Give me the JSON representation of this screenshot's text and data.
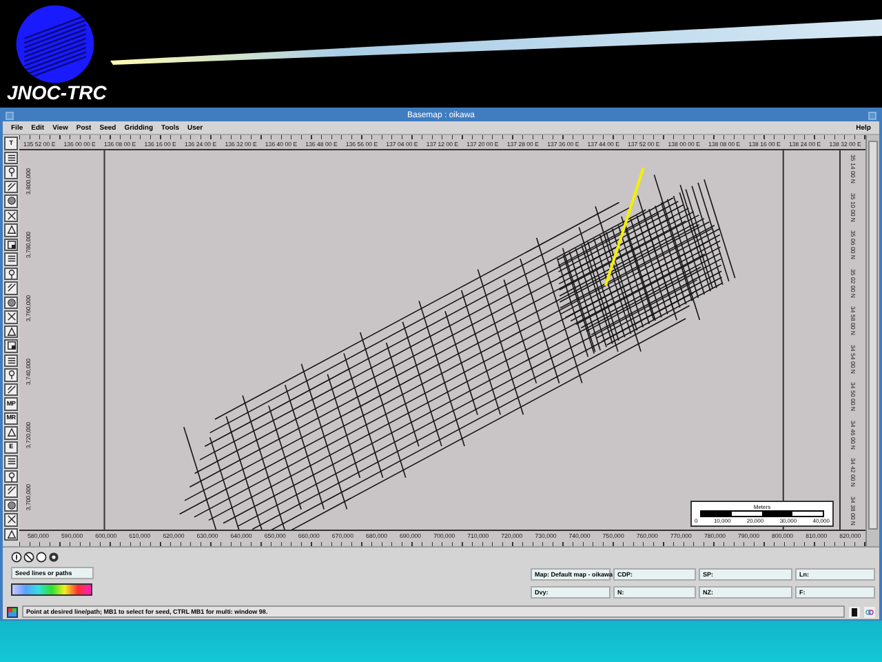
{
  "header": {
    "logo_text": "JNOC-TRC"
  },
  "window": {
    "title": "Basemap : oikawa"
  },
  "menu": {
    "items": [
      "File",
      "Edit",
      "View",
      "Post",
      "Seed",
      "Gridding",
      "Tools",
      "User"
    ],
    "help": "Help"
  },
  "toolbar": [
    {
      "kind": "text",
      "label": "T"
    },
    {
      "kind": "icon"
    },
    {
      "kind": "icon"
    },
    {
      "kind": "icon"
    },
    {
      "kind": "icon"
    },
    {
      "kind": "icon"
    },
    {
      "kind": "icon"
    },
    {
      "kind": "icon"
    },
    {
      "kind": "icon"
    },
    {
      "kind": "icon"
    },
    {
      "kind": "icon"
    },
    {
      "kind": "icon"
    },
    {
      "kind": "icon"
    },
    {
      "kind": "icon"
    },
    {
      "kind": "icon"
    },
    {
      "kind": "icon"
    },
    {
      "kind": "icon"
    },
    {
      "kind": "icon"
    },
    {
      "kind": "text",
      "label": "MP"
    },
    {
      "kind": "text",
      "label": "MR"
    },
    {
      "kind": "icon"
    },
    {
      "kind": "text",
      "label": "E"
    },
    {
      "kind": "icon"
    },
    {
      "kind": "icon"
    },
    {
      "kind": "icon"
    },
    {
      "kind": "icon"
    },
    {
      "kind": "icon"
    },
    {
      "kind": "icon"
    }
  ],
  "map": {
    "top_axis_labels": [
      "135 52 00 E",
      "136 00 00 E",
      "136 08 00 E",
      "136 16 00 E",
      "136 24 00 E",
      "136 32 00 E",
      "136 40 00 E",
      "136 48 00 E",
      "136 56 00 E",
      "137 04 00 E",
      "137 12 00 E",
      "137 20 00 E",
      "137 28 00 E",
      "137 36 00 E",
      "137 44 00 E",
      "137 52 00 E",
      "138 00 00 E",
      "138 08 00 E",
      "138 16 00 E",
      "138 24 00 E",
      "138 32 00 E"
    ],
    "bottom_axis_labels": [
      "580,000",
      "590,000",
      "600,000",
      "610,000",
      "620,000",
      "630,000",
      "640,000",
      "650,000",
      "660,000",
      "670,000",
      "680,000",
      "690,000",
      "700,000",
      "710,000",
      "720,000",
      "730,000",
      "740,000",
      "750,000",
      "760,000",
      "770,000",
      "780,000",
      "790,000",
      "800,000",
      "810,000",
      "820,000"
    ],
    "left_axis_labels": [
      "3,800,000",
      "3,780,000",
      "3,760,000",
      "3,740,000",
      "3,720,000",
      "3,700,000"
    ],
    "right_axis_labels": [
      "35 14 00 N",
      "35 10 00 N",
      "35 06 00 N",
      "35 02 00 N",
      "34 58 00 N",
      "34 54 00 N",
      "34 50 00 N",
      "34 46 00 N",
      "34 42 00 N",
      "34 38 00 N"
    ],
    "scale_bar": {
      "title": "Meters",
      "labels": [
        "0",
        "10,000",
        "20,000",
        "30,000",
        "40,000"
      ]
    }
  },
  "seed_panel": {
    "label": "Seed lines or paths"
  },
  "info_fields": [
    "Map: Default map - oikawa",
    "CDP:",
    "SP:",
    "Ln:",
    "Dvy:",
    "N:",
    "NZ:",
    "F:"
  ],
  "status_bar": {
    "message": "Point at desired line/path; MB1 to select for seed, CTRL MB1 for multi: window 98."
  }
}
